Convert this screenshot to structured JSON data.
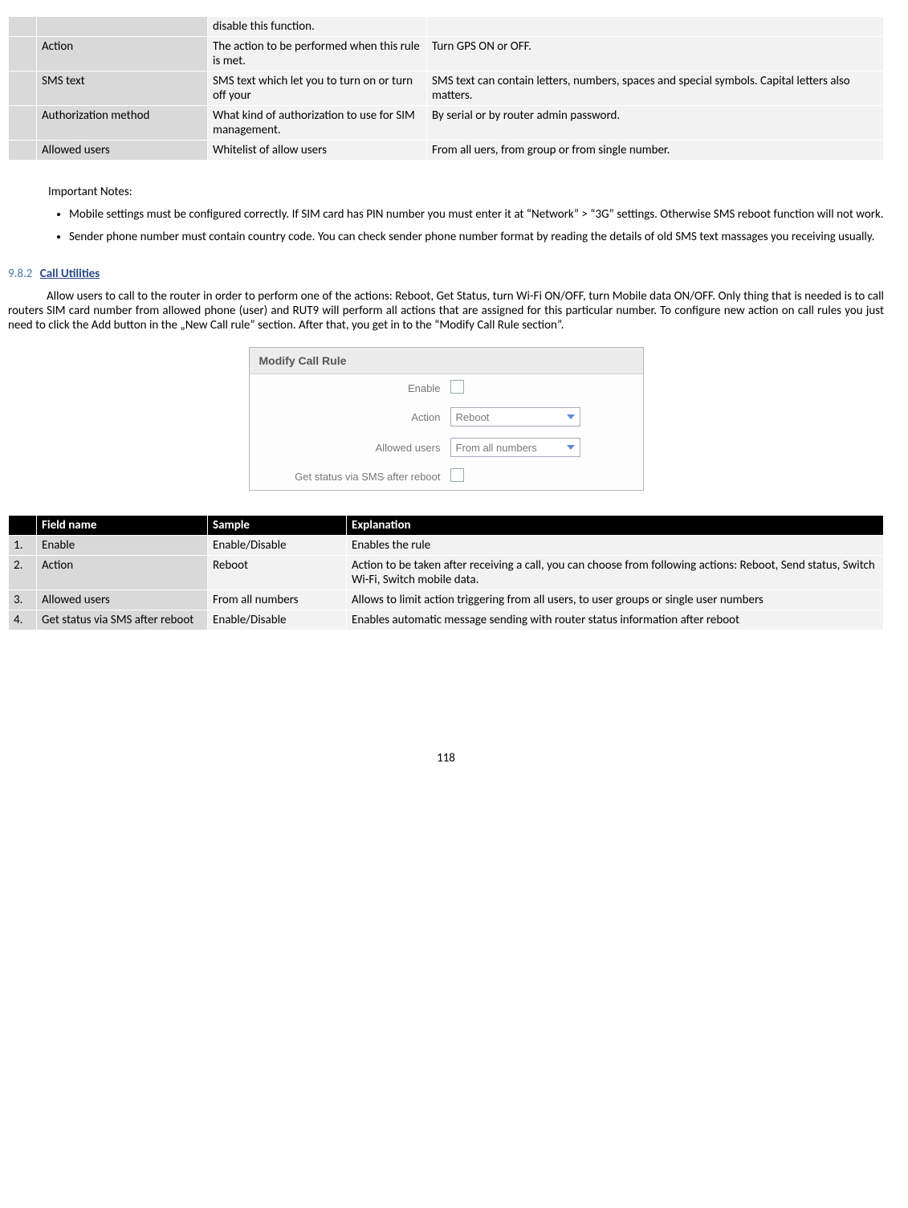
{
  "table1": {
    "rows": [
      {
        "a": "",
        "b": "disable this function.",
        "c": ""
      },
      {
        "a": "Action",
        "b": "The action to be performed when this rule is met.",
        "c": "Turn GPS ON or OFF."
      },
      {
        "a": "SMS text",
        "b": "SMS text which let you to turn on or turn off your",
        "c": "SMS text can contain letters, numbers, spaces and special symbols. Capital letters also matters."
      },
      {
        "a": "Authorization method",
        "b": "What kind of authorization to use for SIM management.",
        "c": "By serial or by router admin password."
      },
      {
        "a": "Allowed users",
        "b": "Whitelist of allow users",
        "c": "From all uers, from group or from single number."
      }
    ]
  },
  "notes": {
    "heading": "Important Notes:",
    "items": [
      "Mobile settings must be configured correctly. If SIM card has PIN number you must enter it at “Network” > “3G” settings. Otherwise SMS reboot function will not work.",
      "Sender phone number must contain country code. You can check sender phone number format by reading the details of old SMS text massages you receiving usually."
    ]
  },
  "section": {
    "num": "9.8.2",
    "title": "Call Utilities",
    "paragraph": "Allow users to call to the router in order to perform one of the actions:  Reboot, Get Status, turn Wi-Fi ON/OFF, turn Mobile data ON/OFF. Only thing that is needed is to call routers SIM card number from allowed phone (user) and RUT9 will perform all actions that are assigned for this particular number. To configure new action on call rules you just need to click the Add button in the „New Call rule” section. After that, you get in to the “Modify Call Rule section”."
  },
  "form": {
    "title": "Modify Call Rule",
    "enable_label": "Enable",
    "action_label": "Action",
    "action_value": "Reboot",
    "allowed_label": "Allowed users",
    "allowed_value": "From all numbers",
    "status_label": "Get status via SMS after reboot"
  },
  "table2": {
    "headers": {
      "h1": "",
      "h2": "Field name",
      "h3": "Sample",
      "h4": "Explanation"
    },
    "rows": [
      {
        "n": "1.",
        "a": "Enable",
        "b": "Enable/Disable",
        "c": "Enables the rule"
      },
      {
        "n": "2.",
        "a": "Action",
        "b": "Reboot",
        "c": "Action to be taken after receiving a call, you can choose from following actions: Reboot, Send status, Switch Wi-Fi, Switch mobile data."
      },
      {
        "n": "3.",
        "a": "Allowed users",
        "b": "From all numbers",
        "c": "Allows to limit action triggering from all users, to user groups or single user numbers"
      },
      {
        "n": "4.",
        "a": "Get status via SMS after reboot",
        "b": "Enable/Disable",
        "c": "Enables automatic message sending with router status information after reboot"
      }
    ]
  },
  "page_number": "118"
}
